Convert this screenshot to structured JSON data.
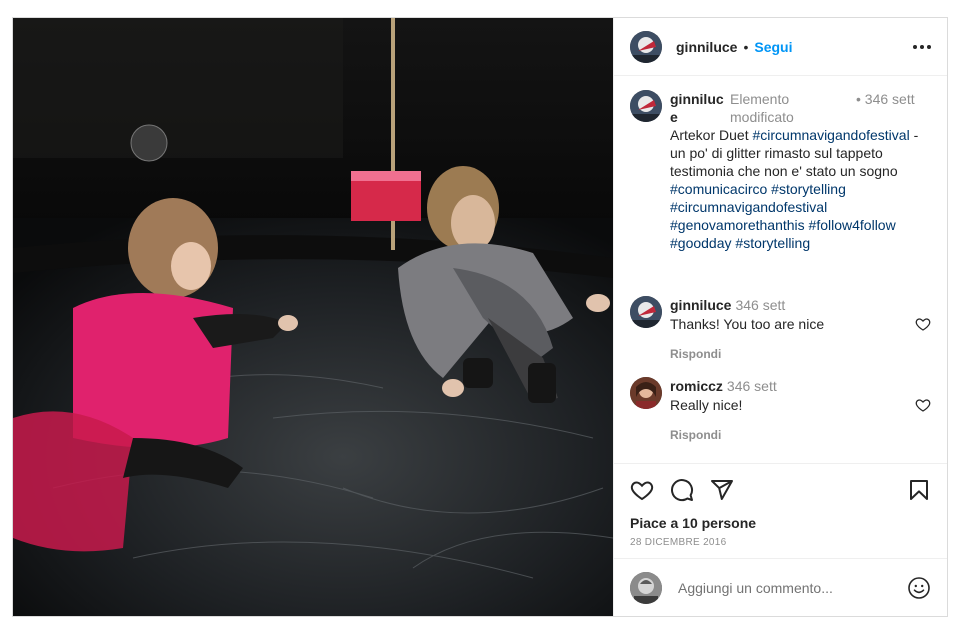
{
  "post": {
    "username": "ginniluce",
    "follow_label": "Segui",
    "caption": {
      "username": "ginniluce",
      "edited": "Elemento modificato",
      "time": "• 346 sett",
      "text_before": "Artekor Duet ",
      "tags": [
        "#circumnavigandofestival",
        "#comunicacirco",
        "#storytelling",
        "#circumnavigandofestival",
        "#genovamorethanthis",
        "#follow4follow",
        "#goodday",
        "#storytelling"
      ],
      "text_middle": " - un po' di glitter rimasto sul tappeto testimonia che non e' stato un sogno "
    },
    "comments": [
      {
        "user": "ginniluce",
        "time": "346 sett",
        "text": "Thanks! You too are nice",
        "reply": "Rispondi"
      },
      {
        "user": "romiccz",
        "time": "346 sett",
        "text": "Really nice!",
        "reply": "Rispondi"
      }
    ],
    "likes_text": "Piace a 10 persone",
    "date": "28 dicembre 2016",
    "add_comment_placeholder": "Aggiungi un commento..."
  },
  "icons": {
    "more": "more-options-icon",
    "like": "heart-icon",
    "comment": "comment-icon",
    "share": "share-icon",
    "save": "bookmark-icon",
    "emoji": "emoji-icon"
  },
  "colors": {
    "link": "#0095f6",
    "hashtag": "#00376b",
    "muted": "#8e8e8e"
  }
}
